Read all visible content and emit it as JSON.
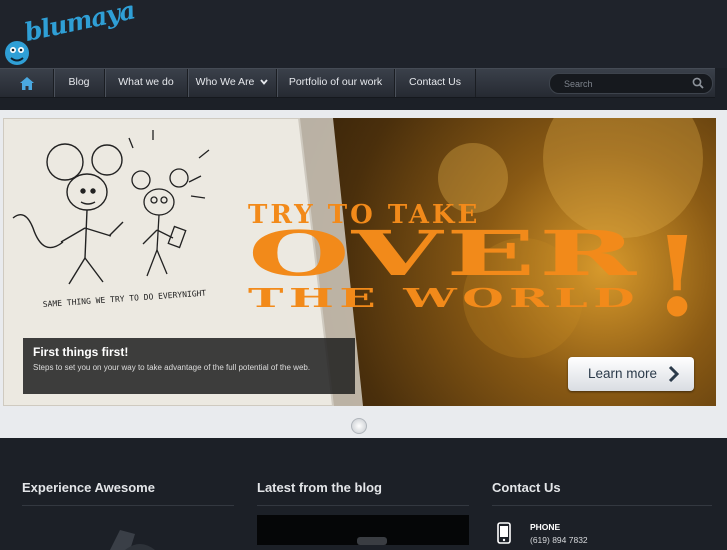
{
  "logo": {
    "text": "blumaya"
  },
  "nav": {
    "items": [
      {
        "label": "Blog"
      },
      {
        "label": "What we do"
      },
      {
        "label": "Who We Are"
      },
      {
        "label": "Portfolio of our work"
      },
      {
        "label": "Contact Us"
      }
    ],
    "search_placeholder": "Search"
  },
  "slide": {
    "headline_line1": "TRY TO TAKE",
    "headline_line2": "OVER",
    "headline_line3": "THE WORLD",
    "headline_bang": "!",
    "sketch_caption": "SAME THING WE TRY TO DO EVERYNIGHT",
    "caption_title": "First things first!",
    "caption_sub": "Steps to set you on your way to take advantage of the full potential of the web.",
    "button_label": "Learn more"
  },
  "footer": {
    "col1_title": "Experience Awesome",
    "col2_title": "Latest from the blog",
    "col3_title": "Contact Us",
    "phone_label": "PHONE",
    "phone_number": "(619) 894 7832"
  },
  "colors": {
    "accent_blue": "#2f9fd6",
    "headline_orange": "#f28a1a"
  }
}
